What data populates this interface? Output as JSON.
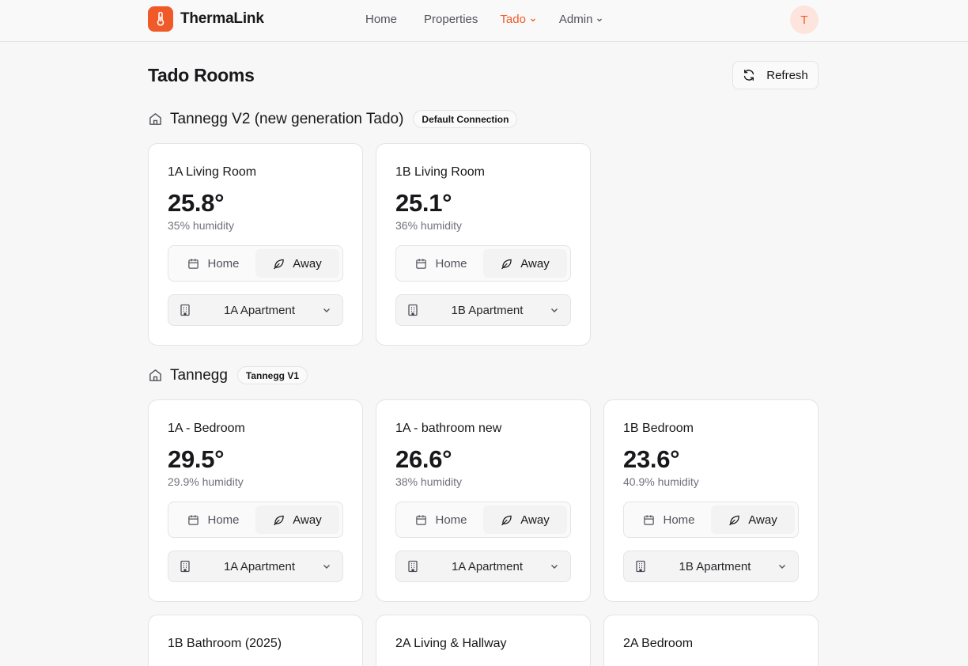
{
  "app": {
    "name": "ThermaLink"
  },
  "nav": {
    "items": [
      {
        "label": "Home",
        "active": false,
        "dropdown": false
      },
      {
        "label": "Properties",
        "active": false,
        "dropdown": false
      },
      {
        "label": "Tado",
        "active": true,
        "dropdown": true
      },
      {
        "label": "Admin",
        "active": false,
        "dropdown": true
      }
    ],
    "avatar_initial": "T"
  },
  "page": {
    "title": "Tado Rooms",
    "refresh_label": "Refresh"
  },
  "toggle_labels": {
    "home": "Home",
    "away": "Away"
  },
  "sections": [
    {
      "name": "Tannegg V2 (new generation Tado)",
      "badge": "Default Connection",
      "rooms": [
        {
          "name": "1A Living Room",
          "temperature": "25.8°",
          "humidity": "35% humidity",
          "mode": "Away",
          "apartment": "1A Apartment"
        },
        {
          "name": "1B Living Room",
          "temperature": "25.1°",
          "humidity": "36% humidity",
          "mode": "Away",
          "apartment": "1B Apartment"
        }
      ]
    },
    {
      "name": "Tannegg",
      "badge": "Tannegg V1",
      "rooms": [
        {
          "name": "1A - Bedroom",
          "temperature": "29.5°",
          "humidity": "29.9% humidity",
          "mode": "Away",
          "apartment": "1A Apartment"
        },
        {
          "name": "1A - bathroom new",
          "temperature": "26.6°",
          "humidity": "38% humidity",
          "mode": "Away",
          "apartment": "1A Apartment"
        },
        {
          "name": "1B Bedroom",
          "temperature": "23.6°",
          "humidity": "40.9% humidity",
          "mode": "Away",
          "apartment": "1B Apartment"
        },
        {
          "name": "1B Bathroom (2025)"
        },
        {
          "name": "2A Living & Hallway"
        },
        {
          "name": "2A Bedroom"
        }
      ]
    }
  ],
  "colors": {
    "accent": "#f05a28",
    "avatar_bg": "#fde4dd",
    "background": "#f7f7f7"
  }
}
